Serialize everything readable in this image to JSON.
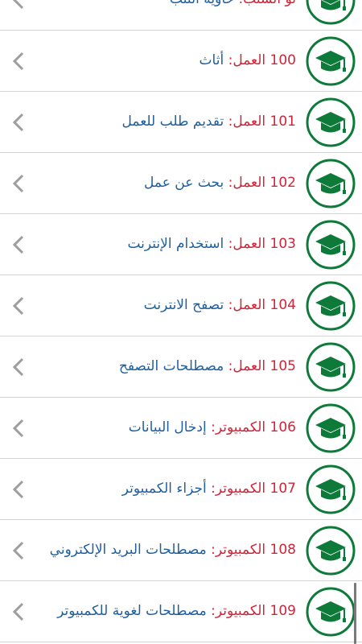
{
  "items": [
    {
      "category": "ثو الشتب:",
      "title": "حاوية التنب"
    },
    {
      "category": "100 العمل:",
      "title": "أثاث"
    },
    {
      "category": "101 العمل:",
      "title": "تقديم طلب للعمل"
    },
    {
      "category": "102 العمل:",
      "title": "بحث عن عمل"
    },
    {
      "category": "103 العمل:",
      "title": "استخدام الإنترنت"
    },
    {
      "category": "104 العمل:",
      "title": "تصفح الانترنت"
    },
    {
      "category": "105 العمل:",
      "title": "مصطلحات التصفح"
    },
    {
      "category": "106 الكمبيوتر:",
      "title": "إدخال البيانات"
    },
    {
      "category": "107 الكمبيوتر:",
      "title": "أجزاء الكمبيوتر"
    },
    {
      "category": "108 الكمبيوتر:",
      "title": "مصطلحات البريد الإلكتروني"
    },
    {
      "category": "109 الكمبيوتر:",
      "title": "مصطلحات لغوية للكمبيوتر"
    }
  ],
  "icons": {
    "row_icon": "graduation-cap-icon",
    "chevron": "chevron-left-icon"
  },
  "colors": {
    "category": "#d0243a",
    "title": "#1f5f9e",
    "icon_green": "#0d7a3a",
    "chevron": "#9e9e9e"
  }
}
